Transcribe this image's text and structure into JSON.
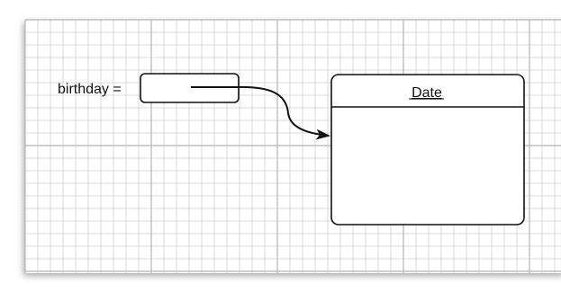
{
  "diagram": {
    "variable": {
      "label": "birthday ="
    },
    "object": {
      "class_name": "Date"
    },
    "colors": {
      "grid_minor": "#cfcfcf",
      "grid_major": "#b4b4b4",
      "paper": "#ffffff",
      "shadow": "#dadada",
      "box_stroke": "#111111",
      "box_fill": "#ffffff"
    }
  }
}
